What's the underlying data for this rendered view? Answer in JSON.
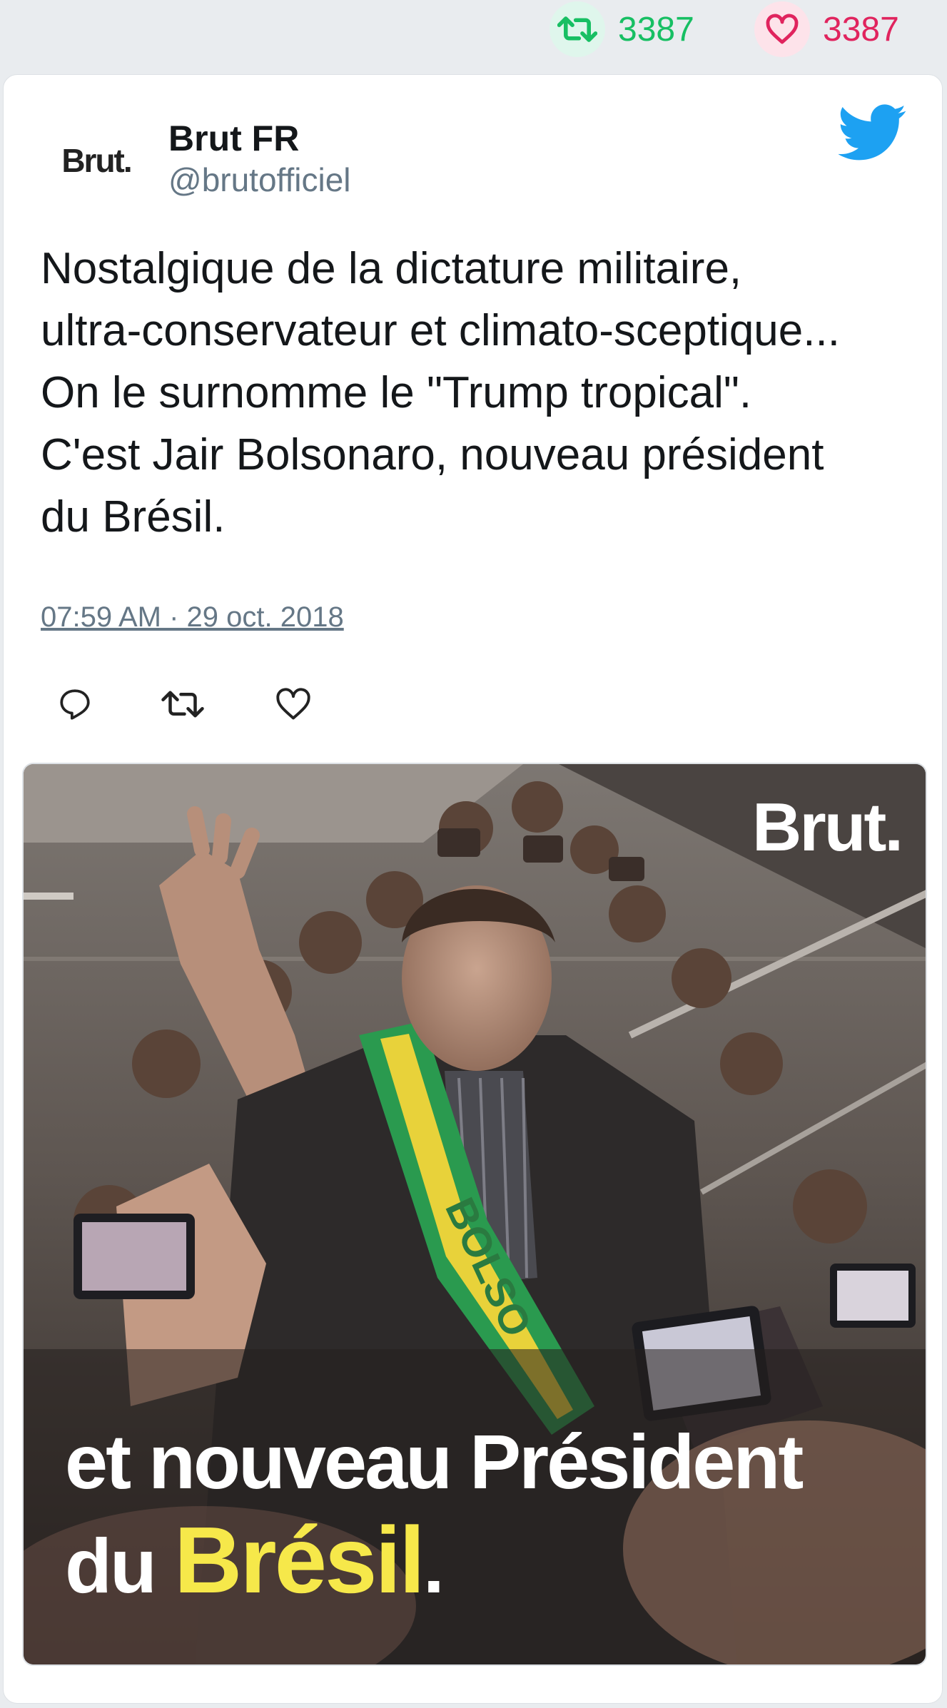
{
  "stats": {
    "retweets": "3387",
    "likes": "3387",
    "icons": {
      "retweet": "retweet-icon",
      "like": "heart-icon"
    },
    "colors": {
      "retweet": "#17bf63",
      "like": "#e0245e"
    }
  },
  "tweet": {
    "avatar_text": "Brut.",
    "name": "Brut FR",
    "handle": "@brutofficiel",
    "text_lines": [
      "Nostalgique de la dictature militaire,",
      "ultra-conservateur et climato-sceptique...",
      "On le surnomme le \"Trump tropical\".",
      "C'est Jair Bolsonaro, nouveau président",
      "du Brésil."
    ],
    "timestamp": "07:59 AM · 29 oct. 2018",
    "platform_icon": "twitter-bird-icon",
    "actions": [
      "reply-icon",
      "retweet-icon",
      "like-icon"
    ]
  },
  "media": {
    "logo": "Brut.",
    "caption_line1": "et nouveau Président",
    "caption_line2_prefix": "du ",
    "caption_line2_highlight": "Brésil",
    "caption_line2_suffix": ".",
    "highlight_color": "#f6e84a",
    "sash_text": "BOLSO"
  }
}
